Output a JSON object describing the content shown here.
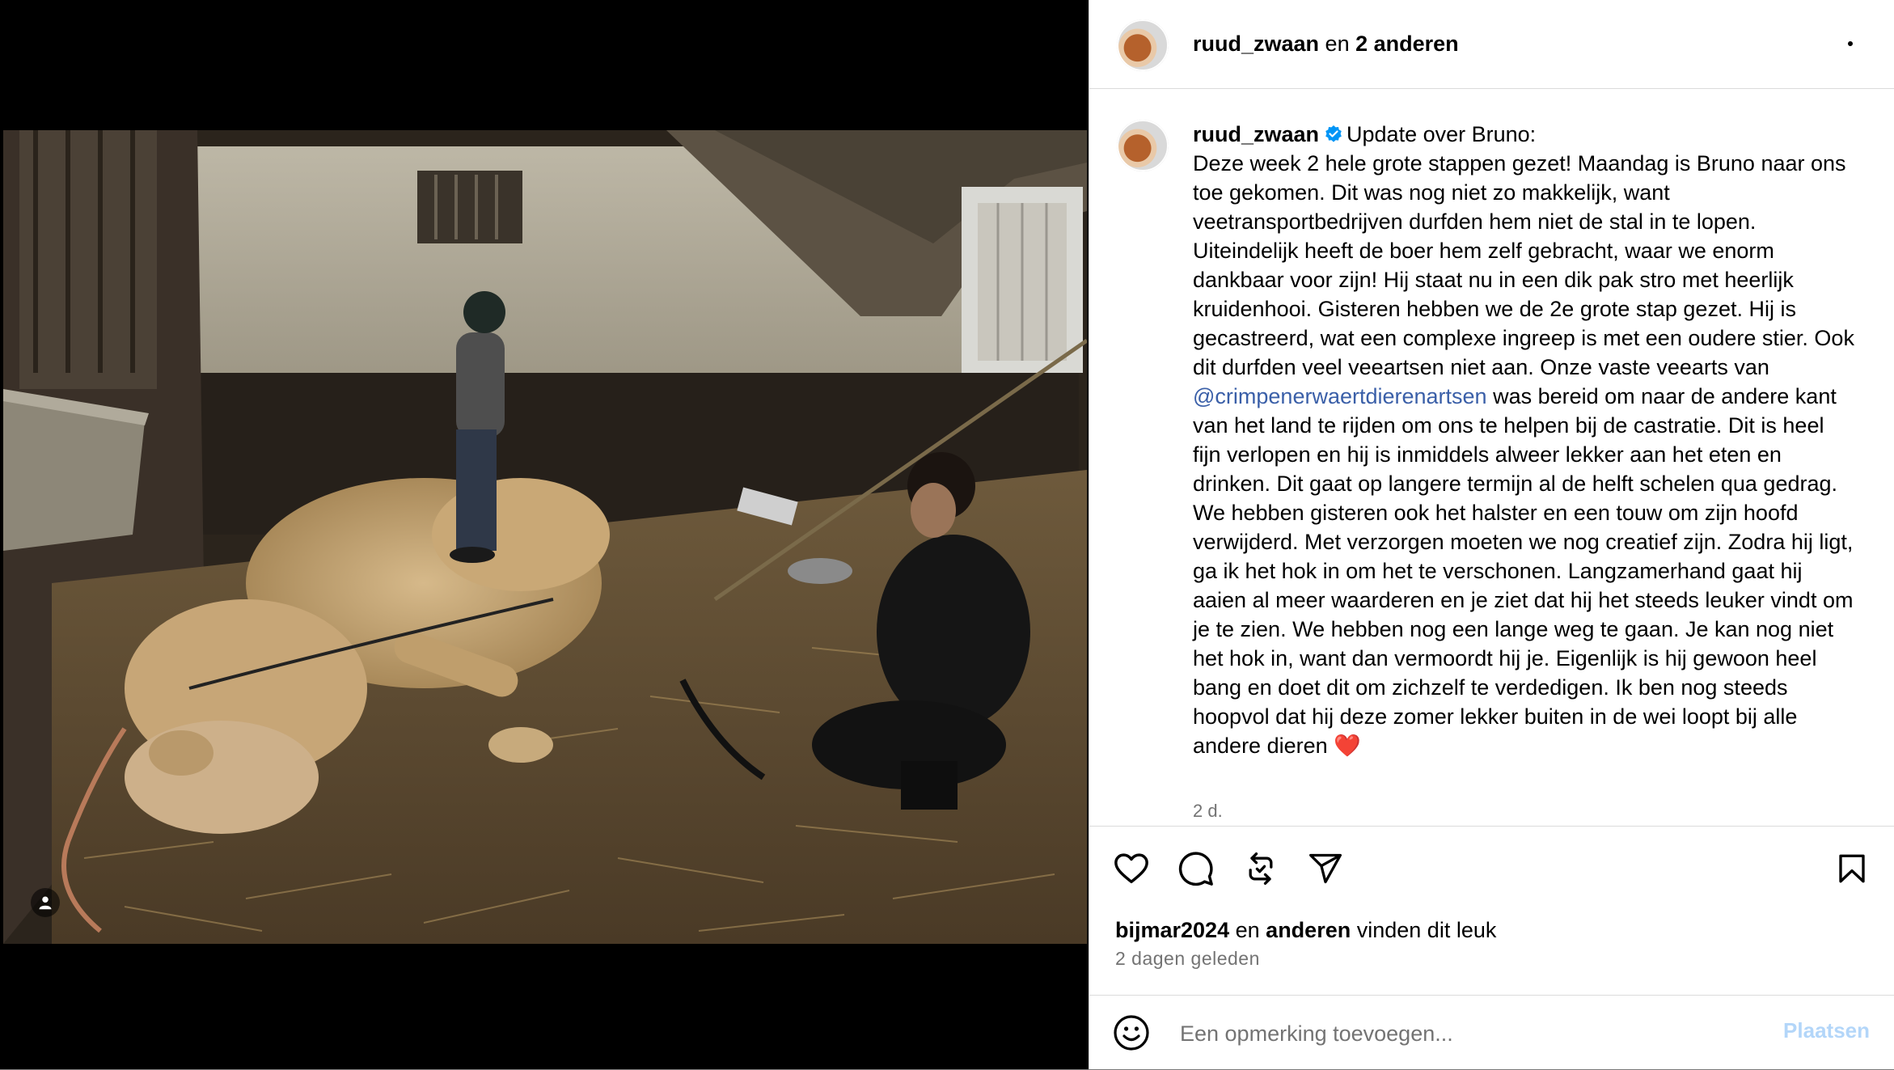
{
  "post": {
    "owner": "ruud_zwaan",
    "coauthors_prefix": "en",
    "coauthors": "2 anderen"
  },
  "caption": {
    "username": "ruud_zwaan",
    "title": "Update over Bruno:",
    "text_before_mention": "Deze week 2 hele grote stappen gezet! Maandag is Bruno naar ons toe gekomen. Dit was nog niet zo makkelijk, want veetransportbedrijven durfden hem niet de stal in te lopen. Uiteindelijk heeft de boer hem zelf gebracht, waar we enorm dankbaar voor zijn! Hij staat nu in een dik pak stro met heerlijk kruidenhooi. Gisteren hebben we de 2e grote stap gezet. Hij is gecastreerd, wat een complexe ingreep is met een oudere stier. Ook dit durfden veel veeartsen niet aan. Onze vaste veearts van ",
    "mention": "@crimpenerwaertdierenartsen",
    "text_after_mention": " was bereid om naar de andere kant van het land te rijden om ons te helpen bij de castratie. Dit is heel fijn verlopen en hij is inmiddels alweer lekker aan het eten en drinken. Dit gaat op langere termijn al de helft schelen qua gedrag. We hebben gisteren ook het halster en een touw om zijn hoofd verwijderd. Met verzorgen moeten we nog creatief zijn. Zodra hij ligt, ga ik het hok in om het te verschonen. Langzamerhand gaat hij aaien al meer waarderen en je ziet dat hij het steeds leuker vindt om je te zien. We hebben nog een lange weg te gaan. Je kan nog niet het hok in, want dan vermoordt hij je. Eigenlijk is hij gewoon heel bang en doet dit om zichzelf te verdedigen. Ik ben nog steeds hoopvol dat hij deze zomer lekker buiten in de wei loopt bij alle andere dieren ",
    "emoji": "❤️",
    "time": "2 d."
  },
  "likes": {
    "user": "bijmar2024",
    "middle": "en",
    "others": "anderen",
    "suffix": "vinden dit leuk"
  },
  "date": "2 dagen geleden",
  "comment": {
    "placeholder": "Een opmerking toevoegen...",
    "post_label": "Plaatsen"
  },
  "icons": {
    "more": "more-horizontal-icon",
    "like": "heart-icon",
    "comment": "comment-bubble-icon",
    "repost": "repost-icon",
    "share": "send-icon",
    "save": "bookmark-icon",
    "emoji": "emoji-smile-icon",
    "tag": "user-tag-icon",
    "verified": "verified-badge-icon"
  },
  "colors": {
    "mention": "#3a5fa8",
    "verified": "#0095f6",
    "post_disabled": "#b3d6f9",
    "secondary_text": "#737373"
  }
}
